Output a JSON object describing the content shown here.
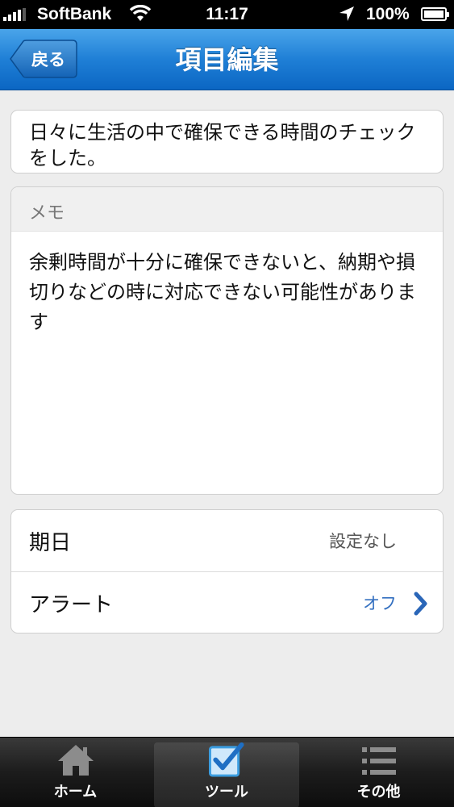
{
  "status_bar": {
    "carrier": "SoftBank",
    "time": "11:17",
    "battery": "100%"
  },
  "nav": {
    "back_label": "戻る",
    "title": "項目編集"
  },
  "item": {
    "title": "日々に生活の中で確保できる時間のチェックをした。",
    "memo_label": "メモ",
    "memo_text": "余剰時間が十分に確保できないと、納期や損切りなどの時に対応できない可能性があります"
  },
  "settings": {
    "due_label": "期日",
    "due_value": "設定なし",
    "alert_label": "アラート",
    "alert_value": "オフ"
  },
  "tabs": {
    "home": "ホーム",
    "tool": "ツール",
    "other": "その他"
  },
  "colors": {
    "nav_blue": "#1f7fd6",
    "link_blue": "#3470c0",
    "tab_icon_blue": "#4aa8e8"
  }
}
